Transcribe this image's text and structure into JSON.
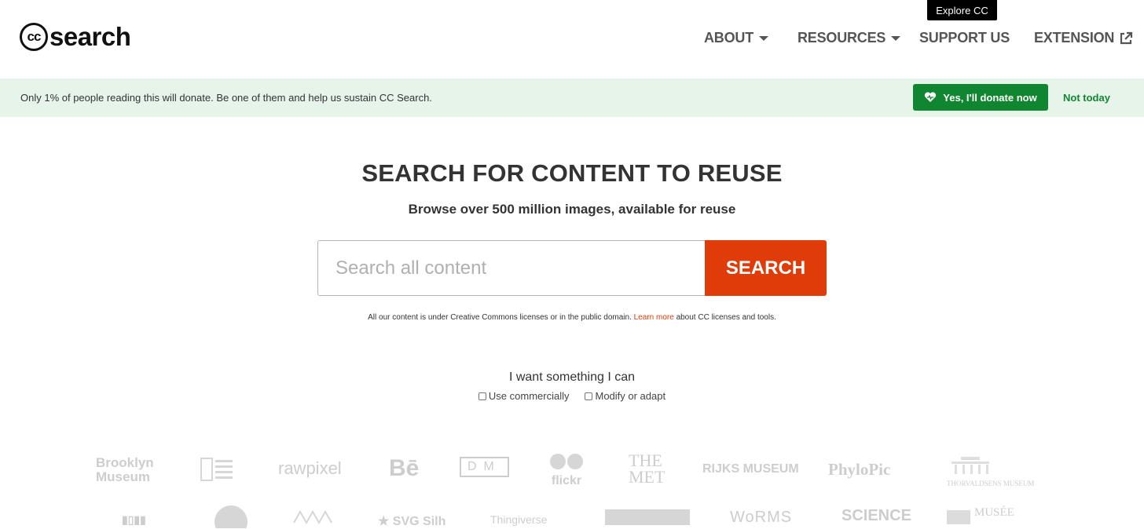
{
  "header": {
    "logo_cc": "cc",
    "logo_text": "search",
    "nav": [
      {
        "label": "ABOUT",
        "has_caret": true
      },
      {
        "label": "RESOURCES",
        "has_caret": true
      },
      {
        "label": "SUPPORT US",
        "has_caret": false
      },
      {
        "label": "EXTENSION",
        "icon": "external-link-icon"
      }
    ],
    "tooltip": "Explore CC"
  },
  "banner": {
    "text": "Only 1% of people reading this will donate. Be one of them and help us sustain CC Search.",
    "donate_label": "Yes, I'll donate now",
    "dismiss_label": "Not today",
    "background": "#e6f4e9",
    "accent": "#118630"
  },
  "hero": {
    "title": "SEARCH FOR CONTENT TO REUSE",
    "subtitle": "Browse over 500 million images, available for reuse",
    "search_placeholder": "Search all content",
    "search_value": "",
    "search_button": "SEARCH",
    "search_button_color": "#e03c0a",
    "license_note_pre": "All our content is under Creative Commons licenses or in the public domain.",
    "license_note_link": "Learn more",
    "license_note_post": "about CC licenses and tools."
  },
  "filters": {
    "title": "I want something I can",
    "options": [
      {
        "label": "Use commercially",
        "checked": false
      },
      {
        "label": "Modify or adapt",
        "checked": false
      }
    ]
  },
  "sources": {
    "row1": [
      "Brooklyn",
      "Museum",
      "rawpixel",
      "Bē",
      "DM",
      "flickr",
      "THE",
      "MET",
      "RIJKS MUSEUM",
      "PhyloPic",
      "THORVALDSENS MUSEUM"
    ],
    "row2": [
      "SVG Silh",
      "Thingiverse",
      "WoRMS",
      "SCIENCE",
      "MUSÉE"
    ]
  }
}
